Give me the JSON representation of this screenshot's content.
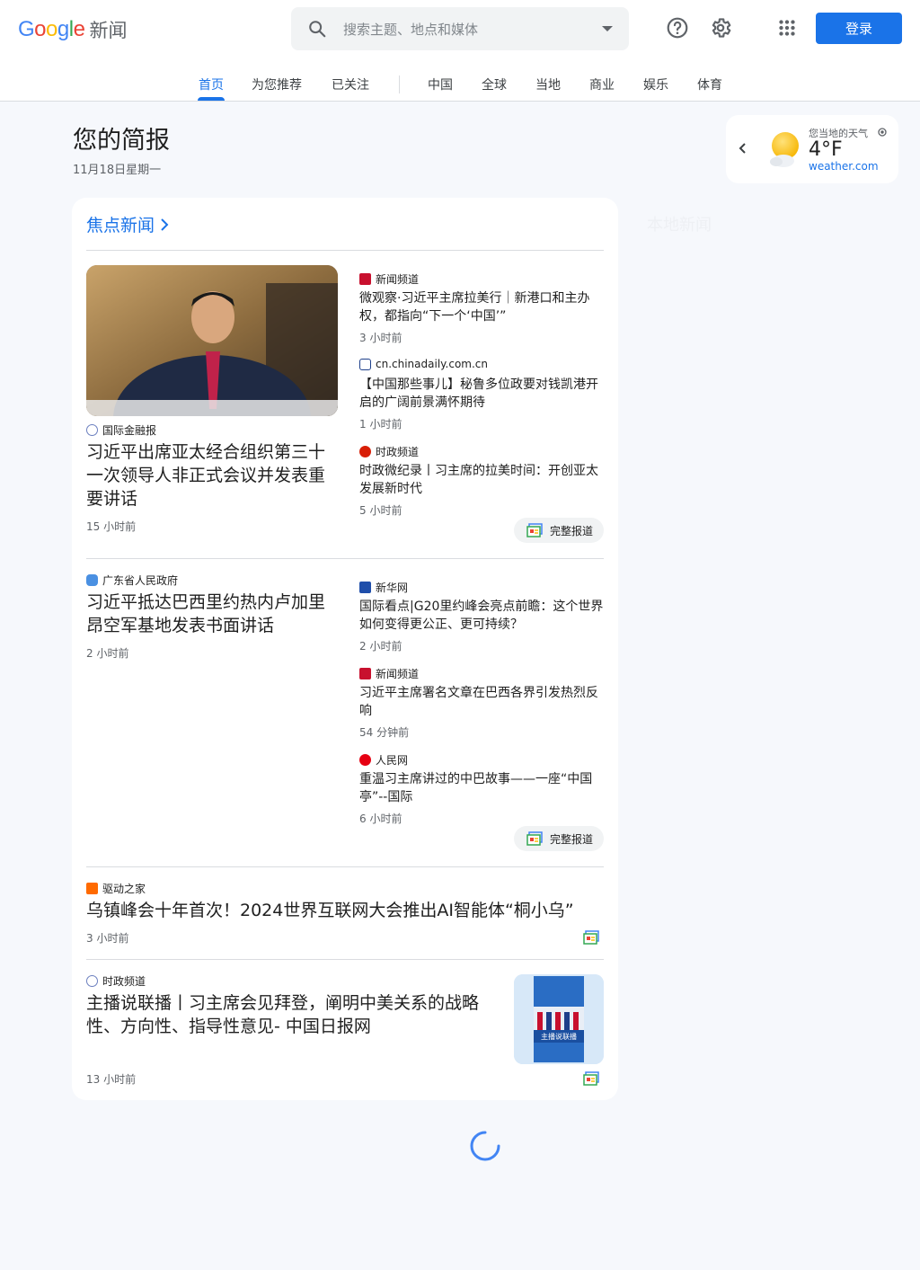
{
  "header": {
    "logo_google": "Google",
    "logo_news": "新闻",
    "search_placeholder": "搜索主题、地点和媒体",
    "login_label": "登录"
  },
  "tabs": [
    "首页",
    "为您推荐",
    "已关注",
    "中国",
    "全球",
    "当地",
    "商业",
    "娱乐",
    "体育"
  ],
  "active_tab": "首页",
  "briefing": {
    "title": "您的简报",
    "date": "11月18日星期一"
  },
  "weather": {
    "label": "您当地的天气",
    "temp": "4°F",
    "source": "weather.com",
    "icon": "sun-cloud-icon"
  },
  "local_news_label": "本地新闻",
  "top_stories": {
    "title": "焦点新闻",
    "full_coverage_label": "完整报道",
    "clusters": [
      {
        "main": {
          "source": "国际金融报",
          "headline": "习近平出席亚太经合组织第三十一次领导人非正式会议并发表重要讲话",
          "time": "15 小时前"
        },
        "related": [
          {
            "source": "新闻频道",
            "headline": "微观察·习近平主席拉美行｜新港口和主办权，都指向“下一个‘中国’”",
            "time": "3 小时前"
          },
          {
            "source": "cn.chinadaily.com.cn",
            "headline": "【中国那些事儿】秘鲁多位政要对钱凯港开启的广阔前景满怀期待",
            "time": "1 小时前"
          },
          {
            "source": "时政频道",
            "headline": "时政微纪录丨习主席的拉美时间：开创亚太发展新时代",
            "time": "5 小时前"
          }
        ]
      },
      {
        "main": {
          "source": "广东省人民政府",
          "headline": "习近平抵达巴西里约热内卢加里昂空军基地发表书面讲话",
          "time": "2 小时前"
        },
        "related": [
          {
            "source": "新华网",
            "headline": "国际看点|G20里约峰会亮点前瞻：这个世界如何变得更公正、更可持续？",
            "time": "2 小时前"
          },
          {
            "source": "新闻频道",
            "headline": "习近平主席署名文章在巴西各界引发热烈反响",
            "time": "54 分钟前"
          },
          {
            "source": "人民网",
            "headline": "重温习主席讲过的中巴故事——一座“中国亭”--国际",
            "time": "6 小时前"
          }
        ]
      }
    ],
    "singles": [
      {
        "source": "驱动之家",
        "headline": "乌镇峰会十年首次！2024世界互联网大会推出AI智能体“桐小乌”",
        "time": "3 小时前"
      },
      {
        "source": "时政频道",
        "headline": "主播说联播丨习主席会见拜登，阐明中美关系的战略性、方向性、指导性意见- 中国日报网",
        "time": "13 小时前",
        "thumb_text": "主播说联播"
      }
    ]
  },
  "colors": {
    "accent": "#1a73e8",
    "text": "#1f1f1f",
    "muted": "#5f6368",
    "bg": "#f6f8fc"
  }
}
